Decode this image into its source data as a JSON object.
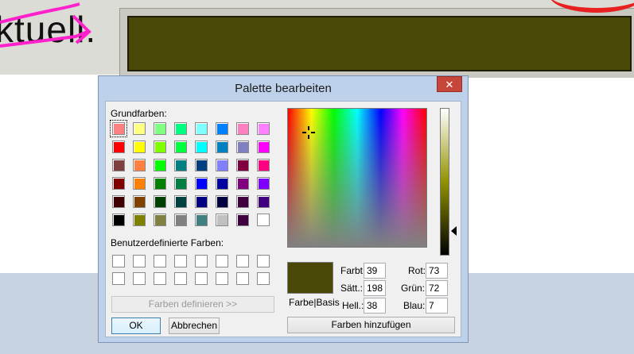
{
  "background": {
    "partial_text": "ktuell.",
    "swatch_color": "#494806"
  },
  "dialog": {
    "title": "Palette bearbeiten",
    "close_glyph": "✕",
    "basic_colors_label": "Grundfarben:",
    "basic_colors": [
      [
        "#ff8080",
        "#ffff80",
        "#80ff80",
        "#00ff80",
        "#80ffff",
        "#0080ff",
        "#ff80c0",
        "#ff80ff"
      ],
      [
        "#ff0000",
        "#ffff00",
        "#80ff00",
        "#00ff40",
        "#00ffff",
        "#0080c0",
        "#8080c0",
        "#ff00ff"
      ],
      [
        "#804040",
        "#ff8040",
        "#00ff00",
        "#008080",
        "#004080",
        "#8080ff",
        "#800040",
        "#ff0080"
      ],
      [
        "#800000",
        "#ff8000",
        "#008000",
        "#008040",
        "#0000ff",
        "#0000a0",
        "#800080",
        "#8000ff"
      ],
      [
        "#400000",
        "#804000",
        "#004000",
        "#004040",
        "#000080",
        "#000040",
        "#400040",
        "#400080"
      ],
      [
        "#000000",
        "#808000",
        "#808040",
        "#808080",
        "#408080",
        "#c0c0c0",
        "#400040",
        "#ffffff"
      ]
    ],
    "custom_colors_label": "Benutzerdefinierte Farben:",
    "define_colors_button": "Farben definieren >>",
    "ok_button": "OK",
    "cancel_button": "Abbrechen",
    "preview_label": "Farbe|Basis",
    "preview_color": "#494806",
    "hue_label": "Farbt.:",
    "hue_value": "39",
    "sat_label": "Sätt.:",
    "sat_value": "198",
    "lum_label": "Hell.:",
    "lum_value": "38",
    "red_label": "Rot:",
    "red_value": "73",
    "green_label": "Grün:",
    "green_value": "72",
    "blue_label": "Blau:",
    "blue_value": "7",
    "add_colors_button": "Farben hinzufügen"
  }
}
